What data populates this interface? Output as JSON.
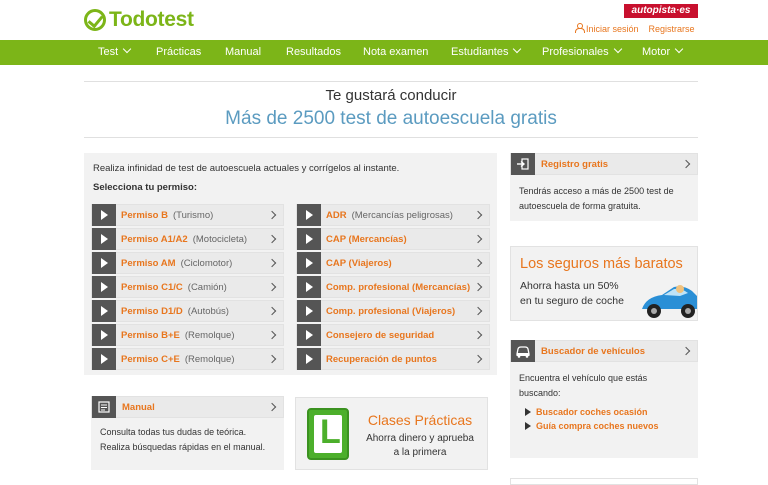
{
  "header": {
    "logo_text": "Todotest",
    "partner_logo": "autopista·es",
    "login": "Iniciar sesión",
    "register": "Registrarse"
  },
  "nav": {
    "items": [
      {
        "label": "Test",
        "dropdown": true
      },
      {
        "label": "Prácticas",
        "dropdown": false
      },
      {
        "label": "Manual",
        "dropdown": false
      },
      {
        "label": "Resultados",
        "dropdown": false
      },
      {
        "label": "Nota examen",
        "dropdown": false
      },
      {
        "label": "Estudiantes",
        "dropdown": true
      },
      {
        "label": "Profesionales",
        "dropdown": true
      },
      {
        "label": "Motor",
        "dropdown": true
      }
    ]
  },
  "hero": {
    "subtitle": "Te gustará conducir",
    "title": "Más de 2500 test de autoescuela gratis"
  },
  "permisos_panel": {
    "intro": "Realiza infinidad de test de autoescuela actuales y corrígelos al instante.",
    "select_label": "Selecciona tu permiso:",
    "left": [
      {
        "name": "Permiso B",
        "desc": "(Turismo)"
      },
      {
        "name": "Permiso A1/A2",
        "desc": "(Motocicleta)"
      },
      {
        "name": "Permiso AM",
        "desc": "(Ciclomotor)"
      },
      {
        "name": "Permiso C1/C",
        "desc": "(Camión)"
      },
      {
        "name": "Permiso D1/D",
        "desc": "(Autobús)"
      },
      {
        "name": "Permiso B+E",
        "desc": "(Remolque)"
      },
      {
        "name": "Permiso C+E",
        "desc": "(Remolque)"
      }
    ],
    "right": [
      {
        "name": "ADR",
        "desc": "(Mercancías peligrosas)"
      },
      {
        "name": "CAP (Mercancías)",
        "desc": ""
      },
      {
        "name": "CAP (Viajeros)",
        "desc": ""
      },
      {
        "name": "Comp. profesional (Mercancías)",
        "desc": ""
      },
      {
        "name": "Comp. profesional (Viajeros)",
        "desc": ""
      },
      {
        "name": "Consejero de seguridad",
        "desc": ""
      },
      {
        "name": "Recuperación de puntos",
        "desc": ""
      }
    ]
  },
  "manual_card": {
    "title": "Manual",
    "body_line1": "Consulta todas tus dudas de teórica.",
    "body_line2": "Realiza búsquedas rápidas en el manual."
  },
  "clases_promo": {
    "plate_letter": "L",
    "title": "Clases Prácticas",
    "text_line1": "Ahorra dinero y aprueba",
    "text_line2": "a la primera"
  },
  "registro_card": {
    "title": "Registro gratis",
    "body_line1": "Tendrás acceso a más de 2500 test de",
    "body_line2": "autoescuela de forma gratuita."
  },
  "seguros_promo": {
    "title": "Los seguros más baratos",
    "text_line1": "Ahorra hasta un 50%",
    "text_line2": "en tu seguro de coche"
  },
  "buscador_card": {
    "title": "Buscador de vehículos",
    "body_line1": "Encuentra el vehículo que estás",
    "body_line2": "buscando:",
    "links": [
      "Buscador coches ocasión",
      "Guía compra coches nuevos"
    ]
  },
  "colors": {
    "brand_green": "#7cb518",
    "accent_orange": "#e8761e",
    "title_blue": "#5b9bc0",
    "dark_icon": "#555555"
  }
}
